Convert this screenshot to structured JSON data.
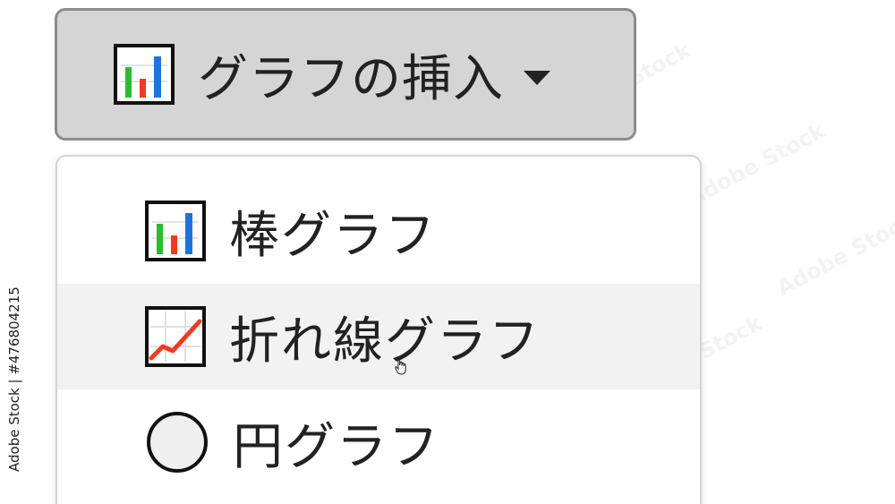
{
  "toolbar": {
    "insert_chart_label": "グラフの挿入",
    "insert_chart_icon": "bar-chart-icon",
    "dropdown_icon": "caret-down-icon"
  },
  "menu": {
    "items": [
      {
        "label": "棒グラフ",
        "icon": "bar-chart-icon"
      },
      {
        "label": "折れ線グラフ",
        "icon": "line-chart-icon"
      },
      {
        "label": "円グラフ",
        "icon": "pie-chart-icon"
      }
    ]
  },
  "overlay": {
    "credit": "Adobe Stock | #476804215",
    "watermark": "Adobe Stock"
  },
  "colors": {
    "button_background": "#d5d5d5",
    "button_border": "#8c8c8c",
    "menu_border": "#d4d4d4",
    "hover_background": "#f2f2f2",
    "chart_green": "#2dbb32",
    "chart_red": "#f23a1f",
    "chart_blue": "#1f74d8"
  }
}
